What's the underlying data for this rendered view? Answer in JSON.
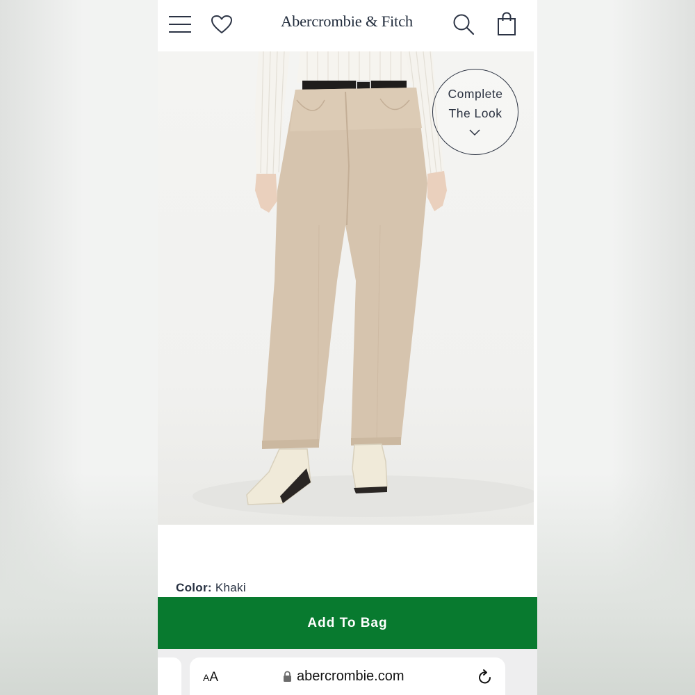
{
  "header": {
    "brand": "Abercrombie & Fitch",
    "icons": [
      "menu-icon",
      "heart-icon",
      "search-icon",
      "shopping-bag-icon"
    ]
  },
  "product": {
    "image_alt": "Khaki high-rise jeans",
    "complete_the_look": {
      "line1": "Complete",
      "line2": "The Look"
    },
    "color_label": "Color:",
    "color_value": "Khaki"
  },
  "cta": {
    "add_to_bag": "Add To Bag",
    "color": "#087a2f"
  },
  "browser": {
    "aa_small": "A",
    "aa_big": "A",
    "url": "abercrombie.com"
  }
}
